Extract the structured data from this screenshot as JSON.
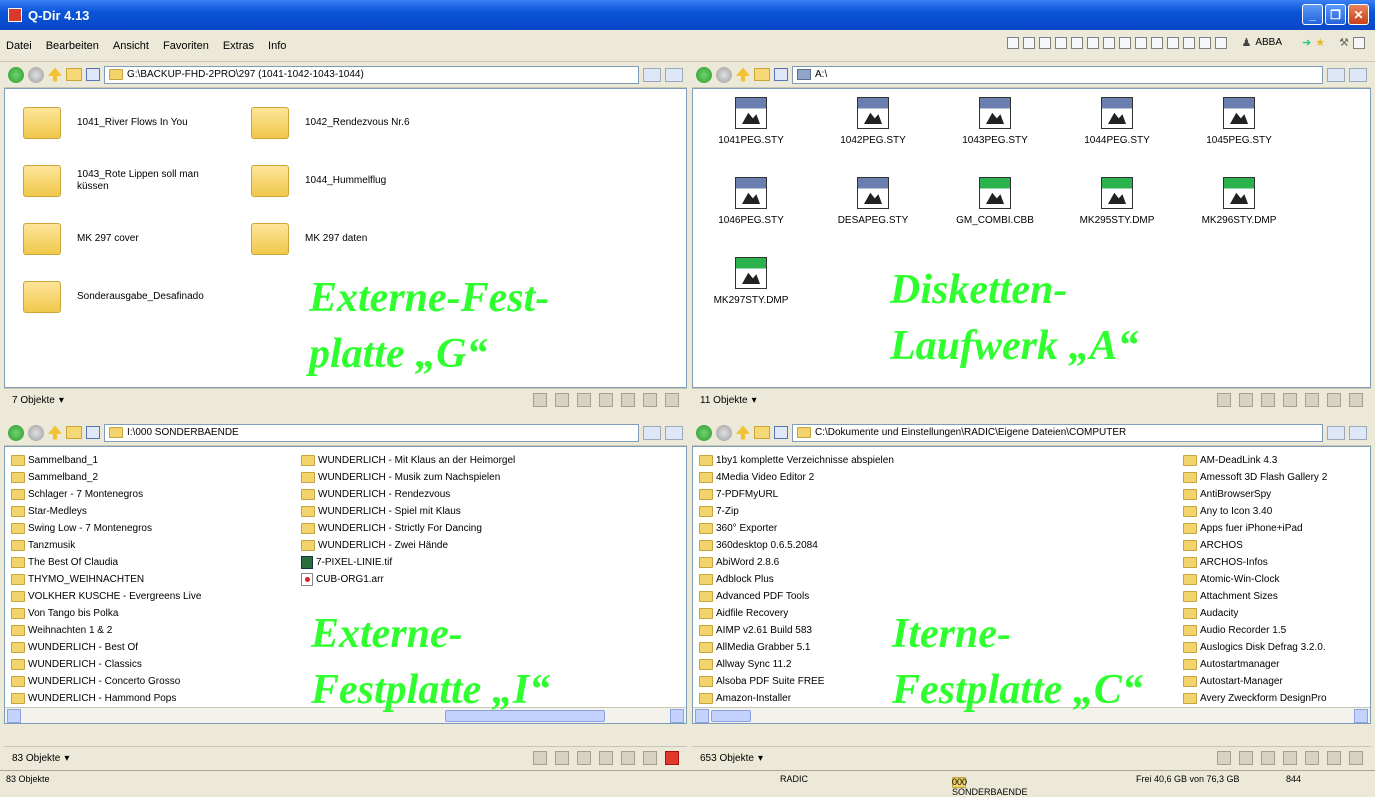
{
  "window": {
    "title": "Q-Dir 4.13"
  },
  "menu": [
    "Datei",
    "Bearbeiten",
    "Ansicht",
    "Favoriten",
    "Extras",
    "Info"
  ],
  "toolbar": {
    "user_label": "ABBA"
  },
  "panes": {
    "tl": {
      "path": "G:\\BACKUP-FHD-2PRO\\297 (1041-1042-1043-1044)",
      "folders": [
        "1041_River Flows In You",
        "1042_Rendezvous Nr.6",
        "1043_Rote Lippen soll man küssen",
        "1044_Hummelflug",
        "MK 297 cover",
        "MK 297 daten",
        "Sonderausgabe_Desafinado"
      ],
      "status": "7 Objekte",
      "overlay_line1": "Externe-Fest-",
      "overlay_line2": "platte „G“"
    },
    "tr": {
      "path": "A:\\",
      "files": [
        "1041PEG.STY",
        "1042PEG.STY",
        "1043PEG.STY",
        "1044PEG.STY",
        "1045PEG.STY",
        "1046PEG.STY",
        "DESAPEG.STY",
        "GM_COMBI.CBB",
        "MK295STY.DMP",
        "MK296STY.DMP",
        "MK297STY.DMP"
      ],
      "status": "11 Objekte",
      "overlay_line1": "Disketten-",
      "overlay_line2": "Laufwerk „A“"
    },
    "bl": {
      "path": "I:\\000 SONDERBAENDE",
      "col1": [
        "Sammelband_1",
        "Sammelband_2",
        "Schlager - 7 Montenegros",
        "Star-Medleys",
        "Swing Low - 7 Montenegros",
        "Tanzmusik",
        "The Best Of Claudia",
        "THYMO_WEIHNACHTEN",
        "VOLKHER KUSCHE - Evergreens Live",
        "Von Tango bis Polka",
        "Weihnachten 1 & 2",
        "WUNDERLICH - Best Of",
        "WUNDERLICH - Classics",
        "WUNDERLICH - Concerto Grosso",
        "WUNDERLICH - Hammond Pops"
      ],
      "col2": [
        "WUNDERLICH - Mit Klaus an der Heimorgel",
        "WUNDERLICH - Musik zum Nachspielen",
        "WUNDERLICH - Rendezvous",
        "WUNDERLICH - Spiel mit Klaus",
        "WUNDERLICH - Strictly For Dancing",
        "WUNDERLICH - Zwei Hände",
        "7-PIXEL-LINIE.tif",
        "CUB-ORG1.arr"
      ],
      "status": "83 Objekte",
      "overlay_line1": "Externe-",
      "overlay_line2": "Festplatte „I“"
    },
    "br": {
      "path": "C:\\Dokumente und Einstellungen\\RADIC\\Eigene Dateien\\COMPUTER",
      "col1": [
        "1by1 komplette Verzeichnisse abspielen",
        "4Media Video Editor 2",
        "7-PDFMyURL",
        "7-Zip",
        "360° Exporter",
        "360desktop 0.6.5.2084",
        "AbiWord 2.8.6",
        "Adblock Plus",
        "Advanced PDF Tools",
        "Aidfile Recovery",
        "AIMP v2.61 Build 583",
        "AllMedia Grabber 5.1",
        "Allway Sync 11.2",
        "Alsoba PDF Suite FREE",
        "Amazon-Installer"
      ],
      "col2": [
        "AM-DeadLink 4.3",
        "Amessoft 3D Flash Gallery 2",
        "AntiBrowserSpy",
        "Any to Icon 3.40",
        "Apps fuer iPhone+iPad",
        "ARCHOS",
        "ARCHOS-Infos",
        "Atomic-Win-Clock",
        "Attachment Sizes",
        "Audacity",
        "Audio Recorder 1.5",
        "Auslogics Disk Defrag 3.2.0.",
        "Autostartmanager",
        "Autostart-Manager",
        "Avery Zweckform DesignPro"
      ],
      "status": "653 Objekte",
      "overlay_line1": "Iterne-",
      "overlay_line2": "Festplatte „C“"
    }
  },
  "bottom": {
    "count": "83 Objekte",
    "user": "RADIC",
    "folder": "000 SONDERBAENDE",
    "free": "Frei 40,6 GB von 76,3 GB",
    "num": "844"
  }
}
